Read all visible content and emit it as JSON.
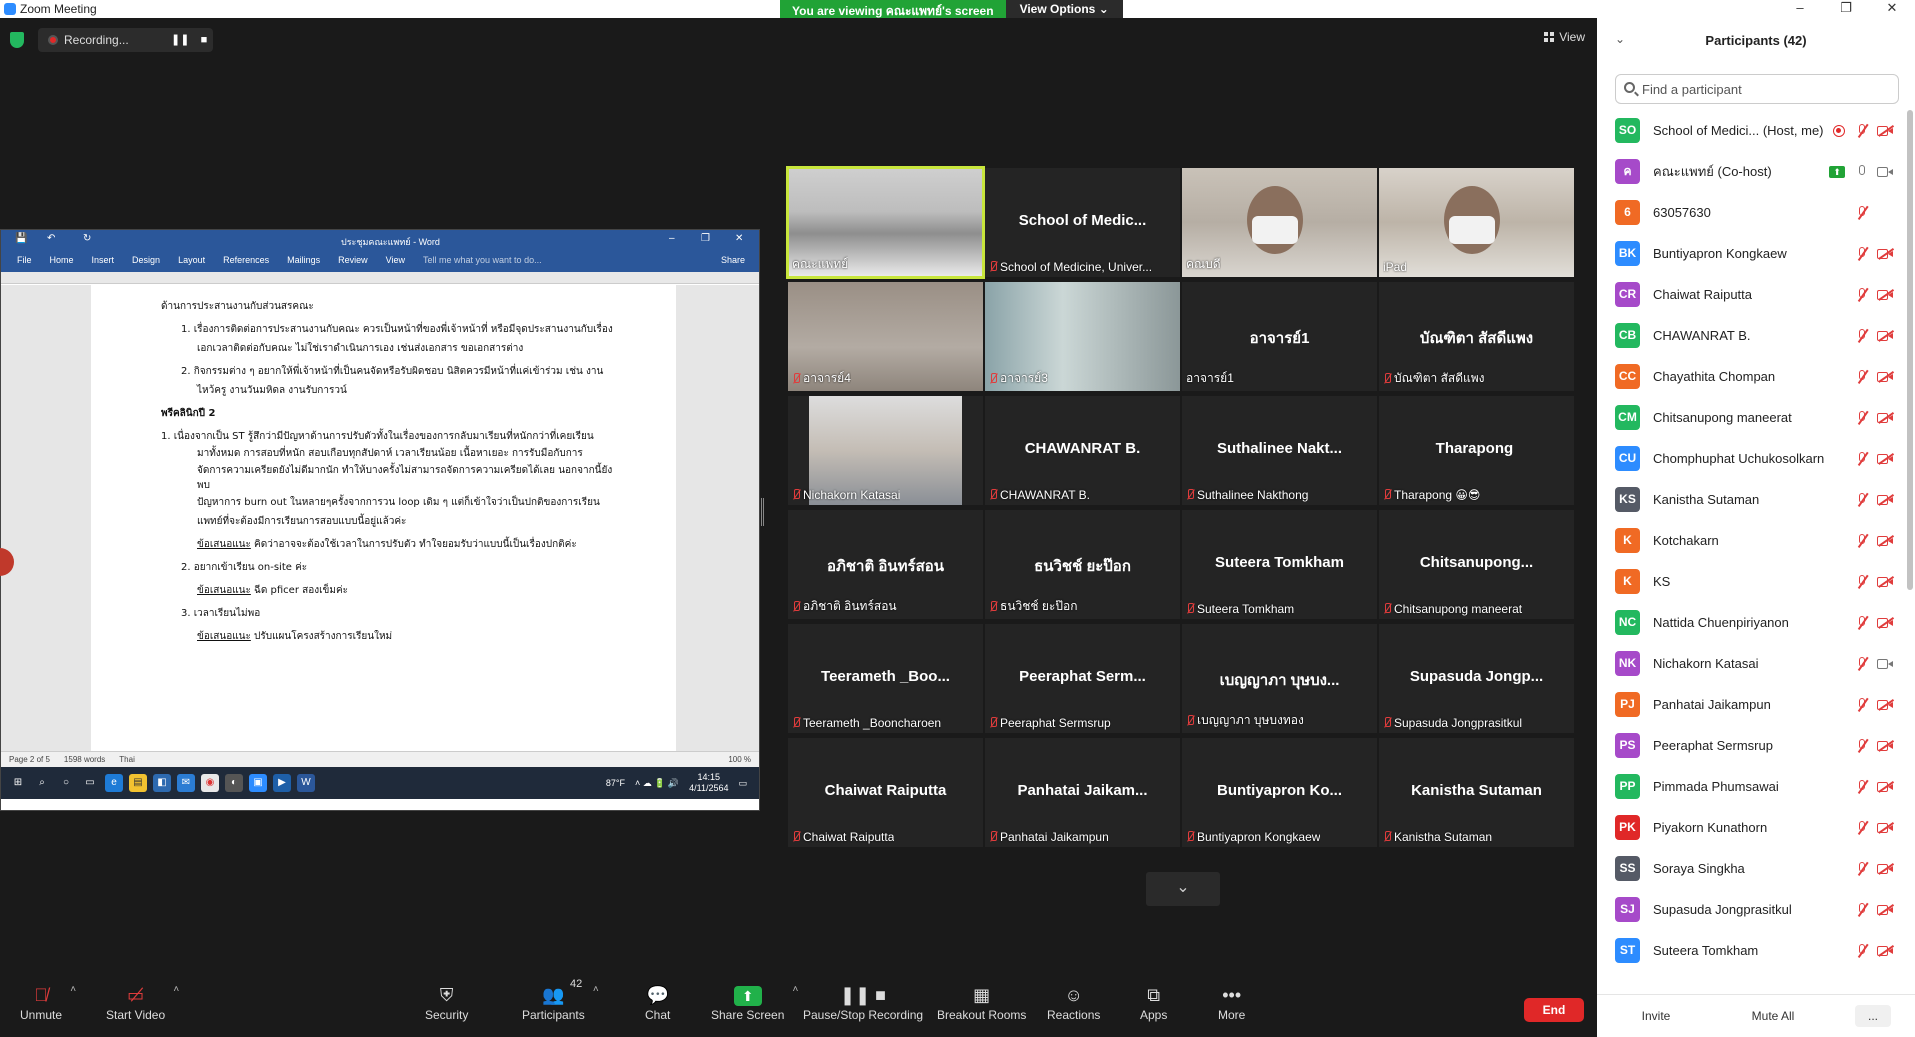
{
  "window": {
    "title": "Zoom Meeting",
    "minimize": "–",
    "restore": "❐",
    "close": "✕"
  },
  "banner": {
    "viewing_text": "You are viewing คณะแพทย์'s screen",
    "view_options": "View Options ⌄"
  },
  "top": {
    "recording_label": "Recording...",
    "pause_glyph": "❚❚",
    "stop_glyph": "■",
    "view_label": "View"
  },
  "word": {
    "title": "ประชุมคณะแพทย์ - Word",
    "menu": [
      "File",
      "Home",
      "Insert",
      "Design",
      "Layout",
      "References",
      "Mailings",
      "Review",
      "View"
    ],
    "tell_me": "Tell me what you want to do...",
    "share": "Share",
    "doc_heading": "ด้านการประสานงานกับส่วนสรคณะ",
    "doc_items": [
      "1.  เรื่องการติดต่อการประสานงานกับคณะ ควรเป็นหน้าที่ของพี่เจ้าหน้าที่ หรือมีจุดประสานงานกับเรื่อง",
      "เอกเวลาติดต่อกับคณะ ไม่ใช่เราดำเนินการเอง เช่นส่งเอกสาร ขอเอกสารต่าง",
      "2.  กิจกรรมต่าง ๆ อยากให้พี่เจ้าหน้าที่เป็นคนจัดหรือรับผิดชอบ นิสิตควรมีหน้าที่แค่เข้าร่วม เช่น งาน",
      "ไหว้ครู งานวันมหิดล งานรับการวน์"
    ],
    "doc_section2": "พรีคลินิกปี 2",
    "doc_para2": [
      "1.  เนื่องจากเป็น ST รู้สึกว่ามีปัญหาด้านการปรับตัวทั้งในเรื่องของการกลับมาเรียนที่หนักกว่าที่เคยเรียน",
      "มาทั้งหมด การสอบที่หนัก สอบเกือบทุกสัปดาห์ เวลาเรียนน้อย เนื้อหาเยอะ การรับมือกับการ",
      "จัดการความเครียดยังไม่ดีมากนัก ทำให้บางครั้งไม่สามารถจัดการความเครียดได้เลย นอกจากนี้ยังพบ",
      "ปัญหาการ burn out ในหลายๆครั้งจากการวน loop เดิม ๆ แต่ก็เข้าใจว่าเป็นปกติของการเรียน",
      "แพทย์ที่จะต้องมีการเรียนการสอบแบบนี้อยู่แล้วค่ะ"
    ],
    "suggest_label": "ข้อเสนอแนะ",
    "suggest1": "คิดว่าอาจจะต้องใช้เวลาในการปรับตัว ทำใจยอมรับว่าแบบนี้เป็นเรื่องปกติค่ะ",
    "item2": "2.  อยากเข้าเรียน on-site ค่ะ",
    "suggest2": "ฉีด pficer สองเข็มค่ะ",
    "item3": "3.  เวลาเรียนไม่พอ",
    "suggest3": "ปรับแผนโครงสร้างการเรียนใหม่",
    "status_page": "Page 2 of 5",
    "status_words": "1598 words",
    "status_lang": "Thai",
    "status_zoom": "100 %",
    "taskbar_temp": "87°F",
    "taskbar_time": "14:15",
    "taskbar_date": "4/11/2564"
  },
  "gallery": [
    {
      "big": "",
      "label": "คณะแพทย์",
      "muted": false,
      "video": "room",
      "active": true
    },
    {
      "big": "School of Medic...",
      "label": "School of Medicine, Univer...",
      "muted": true,
      "video": "none"
    },
    {
      "big": "",
      "label": "คณบดี",
      "muted": false,
      "video": "person"
    },
    {
      "big": "",
      "label": "iPad",
      "muted": false,
      "video": "person2"
    },
    {
      "big": "",
      "label": "อาจารย์4",
      "muted": true,
      "video": "dim"
    },
    {
      "big": "",
      "label": "อาจารย์3",
      "muted": true,
      "video": "light"
    },
    {
      "big": "อาจารย์1",
      "label": "อาจารย์1",
      "muted": false,
      "video": "none"
    },
    {
      "big": "บัณฑิตา สัสดีแพง",
      "label": "บัณฑิตา สัสดีแพง",
      "muted": true,
      "video": "none"
    },
    {
      "big": "",
      "label": "Nichakorn Katasai",
      "muted": true,
      "video": "phone"
    },
    {
      "big": "CHAWANRAT B.",
      "label": "CHAWANRAT B.",
      "muted": true,
      "video": "none"
    },
    {
      "big": "Suthalinee Nakt...",
      "label": "Suthalinee Nakthong",
      "muted": true,
      "video": "none"
    },
    {
      "big": "Tharapong ​​",
      "label": "Tharapong 😀😎",
      "muted": true,
      "video": "none"
    },
    {
      "big": "อภิชาติ อินทร์สอน",
      "label": "อภิชาติ อินทร์สอน",
      "muted": true,
      "video": "none"
    },
    {
      "big": "ธนวิชช์ ยะป๊อก",
      "label": "ธนวิชช์ ยะป๊อก",
      "muted": true,
      "video": "none"
    },
    {
      "big": "Suteera Tomkham",
      "label": "Suteera Tomkham",
      "muted": true,
      "video": "none"
    },
    {
      "big": "Chitsanupong...",
      "label": "Chitsanupong maneerat",
      "muted": true,
      "video": "none"
    },
    {
      "big": "Teerameth _Boo...",
      "label": "Teerameth _Booncharoen",
      "muted": true,
      "video": "none"
    },
    {
      "big": "Peeraphat Serm...",
      "label": "Peeraphat Sermsrup",
      "muted": true,
      "video": "none"
    },
    {
      "big": "เบญญาภา บุษบง...",
      "label": "เบญญาภา บุษบงทอง",
      "muted": true,
      "video": "none"
    },
    {
      "big": "Supasuda Jongp...",
      "label": "Supasuda Jongprasitkul",
      "muted": true,
      "video": "none"
    },
    {
      "big": "Chaiwat Raiputta",
      "label": "Chaiwat Raiputta",
      "muted": true,
      "video": "none"
    },
    {
      "big": "Panhatai Jaikam...",
      "label": "Panhatai Jaikampun",
      "muted": true,
      "video": "none"
    },
    {
      "big": "Buntiyapron Ko...",
      "label": "Buntiyapron Kongkaew",
      "muted": true,
      "video": "none"
    },
    {
      "big": "Kanistha Sutaman",
      "label": "Kanistha Sutaman",
      "muted": true,
      "video": "none"
    }
  ],
  "gallery_scroll": "⌄",
  "toolbar": {
    "unmute": "Unmute",
    "start_video": "Start Video",
    "security": "Security",
    "participants": "Participants",
    "participants_count": "42",
    "chat": "Chat",
    "share_screen": "Share Screen",
    "pause_stop": "Pause/Stop Recording",
    "breakout": "Breakout Rooms",
    "reactions": "Reactions",
    "apps": "Apps",
    "more": "More",
    "end": "End"
  },
  "panel": {
    "title": "Participants (42)",
    "collapse": "⌄",
    "search_placeholder": "Find a participant",
    "participants": [
      {
        "initials": "SO",
        "color": "#23b85f",
        "name": "School of Medici... (Host, me)",
        "mic": "muted",
        "video": "off",
        "extra": "rec"
      },
      {
        "initials": "ค",
        "color": "#a64ac9",
        "name": "คณะแพทย์ (Co-host)",
        "mic": "on",
        "video": "on",
        "extra": "share"
      },
      {
        "initials": "6",
        "color": "#f06a24",
        "name": "63057630",
        "mic": "muted",
        "video": "none",
        "extra": ""
      },
      {
        "initials": "BK",
        "color": "#2d8cff",
        "name": "Buntiyapron Kongkaew",
        "mic": "muted",
        "video": "off",
        "extra": ""
      },
      {
        "initials": "CR",
        "color": "#a64ac9",
        "name": "Chaiwat Raiputta",
        "mic": "muted",
        "video": "off",
        "extra": ""
      },
      {
        "initials": "CB",
        "color": "#23b85f",
        "name": "CHAWANRAT B.",
        "mic": "muted",
        "video": "off",
        "extra": ""
      },
      {
        "initials": "CC",
        "color": "#f06a24",
        "name": "Chayathita Chompan",
        "mic": "muted",
        "video": "off",
        "extra": ""
      },
      {
        "initials": "CM",
        "color": "#23b85f",
        "name": "Chitsanupong maneerat",
        "mic": "muted",
        "video": "off",
        "extra": ""
      },
      {
        "initials": "CU",
        "color": "#2d8cff",
        "name": "Chomphuphat Uchukosolkarn",
        "mic": "muted",
        "video": "off",
        "extra": ""
      },
      {
        "initials": "KS",
        "color": "#555a66",
        "name": "Kanistha Sutaman",
        "mic": "muted",
        "video": "off",
        "extra": ""
      },
      {
        "initials": "K",
        "color": "#f06a24",
        "name": "Kotchakarn",
        "mic": "muted",
        "video": "off",
        "extra": ""
      },
      {
        "initials": "K",
        "color": "#f06a24",
        "name": "KS",
        "mic": "muted",
        "video": "off",
        "extra": ""
      },
      {
        "initials": "NC",
        "color": "#23b85f",
        "name": "Nattida Chuenpiriyanon",
        "mic": "muted",
        "video": "off",
        "extra": ""
      },
      {
        "initials": "NK",
        "color": "#a64ac9",
        "name": "Nichakorn Katasai",
        "mic": "muted",
        "video": "on",
        "extra": ""
      },
      {
        "initials": "PJ",
        "color": "#f06a24",
        "name": "Panhatai Jaikampun",
        "mic": "muted",
        "video": "off",
        "extra": ""
      },
      {
        "initials": "PS",
        "color": "#a64ac9",
        "name": "Peeraphat Sermsrup",
        "mic": "muted",
        "video": "off",
        "extra": ""
      },
      {
        "initials": "PP",
        "color": "#23b85f",
        "name": "Pimmada Phumsawai",
        "mic": "muted",
        "video": "off",
        "extra": ""
      },
      {
        "initials": "PK",
        "color": "#e02828",
        "name": "Piyakorn Kunathorn",
        "mic": "muted",
        "video": "off",
        "extra": ""
      },
      {
        "initials": "SS",
        "color": "#555a66",
        "name": "Soraya Singkha",
        "mic": "muted",
        "video": "off",
        "extra": ""
      },
      {
        "initials": "SJ",
        "color": "#a64ac9",
        "name": "Supasuda Jongprasitkul",
        "mic": "muted",
        "video": "off",
        "extra": ""
      },
      {
        "initials": "ST",
        "color": "#2d8cff",
        "name": "Suteera Tomkham",
        "mic": "muted",
        "video": "off",
        "extra": ""
      }
    ],
    "invite": "Invite",
    "mute_all": "Mute All",
    "more": "..."
  }
}
